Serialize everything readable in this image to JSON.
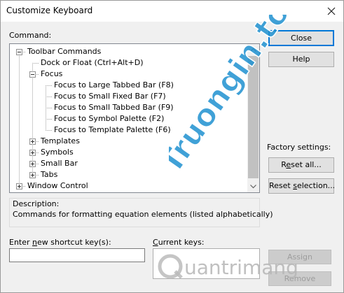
{
  "window": {
    "title": "Customize Keyboard"
  },
  "labels": {
    "command": "Command:",
    "description": "Description:",
    "description_text": "Commands for formatting equation elements  (listed alphabetically)",
    "new_shortcut": "Enter new shortcut key(s):",
    "current_keys": "Current keys:",
    "factory_settings": "Factory settings:"
  },
  "buttons": {
    "close": "Close",
    "help": "Help",
    "reset_all": "Reset all...",
    "reset_selection": "Reset selection...",
    "assign": "Assign",
    "remove": "Remove"
  },
  "tree": [
    {
      "label": "Toolbar Commands",
      "level": 0,
      "state": "expanded"
    },
    {
      "label": "Dock or Float (Ctrl+Alt+D)",
      "level": 1,
      "state": "leaf"
    },
    {
      "label": "Focus",
      "level": 1,
      "state": "expanded"
    },
    {
      "label": "Focus to Large Tabbed Bar (F8)",
      "level": 2,
      "state": "leaf"
    },
    {
      "label": "Focus to Small Fixed Bar (F7)",
      "level": 2,
      "state": "leaf"
    },
    {
      "label": "Focus to Small Tabbed Bar (F9)",
      "level": 2,
      "state": "leaf"
    },
    {
      "label": "Focus to Symbol Palette (F2)",
      "level": 2,
      "state": "leaf"
    },
    {
      "label": "Focus to Template Palette (F6)",
      "level": 2,
      "state": "leaf"
    },
    {
      "label": "Templates",
      "level": 1,
      "state": "collapsed"
    },
    {
      "label": "Symbols",
      "level": 1,
      "state": "collapsed"
    },
    {
      "label": "Small Bar",
      "level": 1,
      "state": "collapsed"
    },
    {
      "label": "Tabs",
      "level": 1,
      "state": "collapsed"
    },
    {
      "label": "Window Control",
      "level": 0,
      "state": "collapsed"
    }
  ],
  "inputs": {
    "new_shortcut_value": "",
    "current_keys_value": ""
  },
  "watermark": {
    "text_1": "Truongin.top",
    "text_2": "uantrimang"
  },
  "colors": {
    "watermark_blue": "#1e90d0",
    "close_red": "#e81123",
    "accent": "#0078d7"
  }
}
